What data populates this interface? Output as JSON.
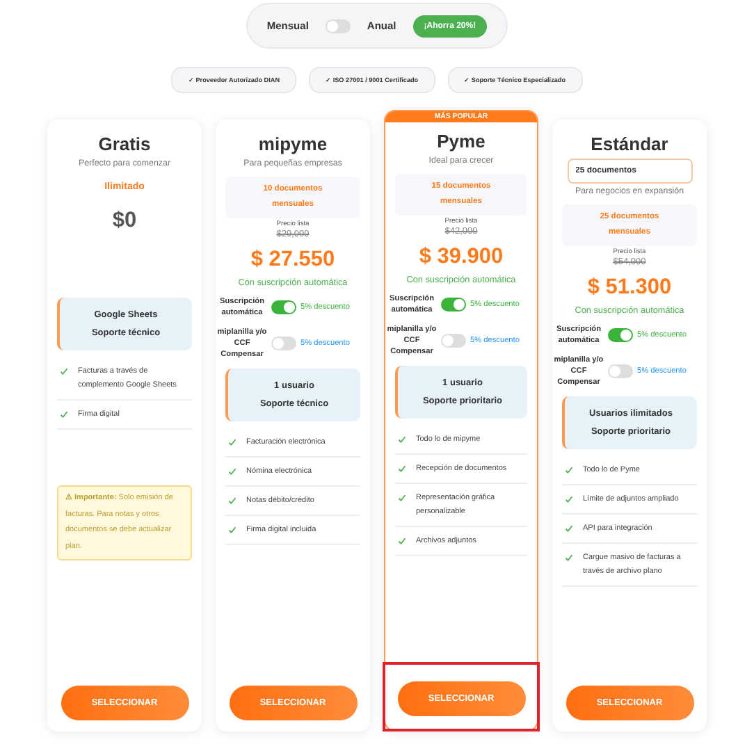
{
  "billing_toggle": {
    "monthly_label": "Mensual",
    "annual_label": "Anual",
    "annual_on": false,
    "savings_badge": "¡Ahorra 20%!"
  },
  "certifications": [
    "✓ Proveedor Autorizado DIAN",
    "✓ ISO 27001 / 9001 Certificado",
    "✓ Soporte Técnico Especializado"
  ],
  "plans": [
    {
      "title": "Gratis",
      "subtitle": "Perfecto para comenzar",
      "limit": "Ilimitado",
      "price": "$0",
      "summary": [
        "Google Sheets",
        "Soporte técnico"
      ],
      "features": [
        "Facturas a través de complemento Google Sheets",
        "Firma digital"
      ],
      "notice": {
        "label": "⚠ Importante:",
        "text": "Solo emisión de facturas. Para notas y otros documentos se debe actualizar plan."
      },
      "button": "SELECCIONAR",
      "popular": false,
      "highlighted": false
    },
    {
      "title": "mipyme",
      "subtitle": "Para pequeñas empresas",
      "quota": "10 documentos mensuales",
      "list_price_label": "Precio lista",
      "list_price": "$29,000",
      "price": "$ 27.550",
      "price_note": "Con suscripción automática",
      "toggles": [
        {
          "label": "Suscripción automática",
          "on": true,
          "discount": "5% descuento"
        },
        {
          "label": "miplanilla y/o CCF Compensar",
          "on": false,
          "discount": "5% descuento"
        }
      ],
      "summary": [
        "1 usuario",
        "Soporte técnico"
      ],
      "features": [
        "Facturación electrónica",
        "Nómina electrónica",
        "Notas débito/crédito",
        "Firma digital incluida"
      ],
      "button": "SELECCIONAR",
      "popular": false,
      "highlighted": false
    },
    {
      "title": "Pyme",
      "subtitle": "Ideal para crecer",
      "quota": "15 documentos mensuales",
      "list_price_label": "Precio lista",
      "list_price": "$42,000",
      "price": "$ 39.900",
      "price_note": "Con suscripción automática",
      "toggles": [
        {
          "label": "Suscripción automática",
          "on": true,
          "discount": "5% descuento"
        },
        {
          "label": "miplanilla y/o CCF Compensar",
          "on": false,
          "discount": "5% descuento"
        }
      ],
      "summary": [
        "1 usuario",
        "Soporte prioritario"
      ],
      "features": [
        "Todo lo de mipyme",
        "Recepción de documentos",
        "Representación gráfica personalizable",
        "Archivos adjuntos"
      ],
      "button": "SELECCIONAR",
      "popular": true,
      "popular_label": "MÁS POPULAR",
      "highlighted": true
    },
    {
      "title": "Estándar",
      "documents_field": "25 documentos",
      "subtitle": "Para negocios en expansión",
      "quota": "25 documentos mensuales",
      "list_price_label": "Precio lista",
      "list_price": "$54,000",
      "price": "$ 51.300",
      "price_note": "Con suscripción automática",
      "toggles": [
        {
          "label": "Suscripción automática",
          "on": true,
          "discount": "5% descuento"
        },
        {
          "label": "miplanilla y/o CCF Compensar",
          "on": false,
          "discount": "5% descuento"
        }
      ],
      "summary": [
        "Usuarios ilimitados",
        "Soporte prioritario"
      ],
      "features": [
        "Todo lo de Pyme",
        "Límite de adjuntos ampliado",
        "API para integración",
        "Cargue masivo de facturas a través de archivo plano"
      ],
      "button": "SELECCIONAR",
      "popular": false,
      "highlighted": false
    }
  ]
}
